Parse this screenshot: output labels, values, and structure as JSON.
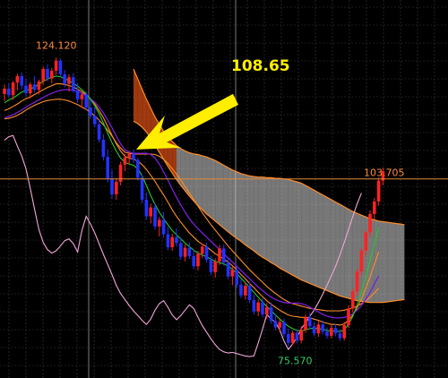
{
  "colors": {
    "background": "#000000",
    "grid": "#3a3a3a",
    "grid_major": "#8a8a8a",
    "bull": "#ff2222",
    "bear": "#2233ff",
    "tenkan": "#22cc22",
    "kijun": "#7a1fd9",
    "chikou": "#f2a6d6",
    "span_a": "#ff8c28",
    "span_b": "#ff8c28",
    "cloud_bull": "#d8d8d8",
    "cloud_bear": "#d24b14",
    "hline": "#e08a3c",
    "label_high": "#ff8a3a",
    "label_low": "#33cc66",
    "callout": "#ffee00",
    "callout_text": "#ffee00"
  },
  "labels": {
    "high": "124.120",
    "low": "75.570",
    "last": "103.705",
    "callout": "108.65"
  },
  "chart_data": {
    "type": "candlestick",
    "title": "",
    "xlabel": "",
    "ylabel": "",
    "ylim": [
      72,
      132
    ],
    "grid": true,
    "horizontal_line": 103.705,
    "annotations": [
      {
        "text": "124.120",
        "value": 124.12,
        "kind": "high"
      },
      {
        "text": "75.570",
        "value": 75.57,
        "kind": "low"
      },
      {
        "text": "103.705",
        "value": 103.705,
        "kind": "last"
      },
      {
        "text": "108.65",
        "value": 108.65,
        "kind": "callout-arrow"
      }
    ],
    "candles": [
      [
        118.0,
        119.6,
        116.8,
        118.9
      ],
      [
        118.9,
        119.8,
        117.4,
        117.8
      ],
      [
        117.8,
        120.2,
        117.0,
        119.9
      ],
      [
        119.9,
        121.4,
        118.6,
        121.0
      ],
      [
        121.0,
        121.6,
        118.8,
        119.4
      ],
      [
        119.4,
        120.6,
        117.6,
        118.1
      ],
      [
        118.1,
        120.0,
        117.2,
        119.6
      ],
      [
        119.6,
        121.0,
        118.2,
        118.7
      ],
      [
        118.7,
        120.4,
        117.9,
        120.1
      ],
      [
        120.1,
        122.6,
        119.5,
        122.2
      ],
      [
        122.2,
        123.0,
        120.1,
        120.6
      ],
      [
        120.6,
        122.4,
        119.8,
        121.9
      ],
      [
        121.9,
        124.1,
        121.2,
        123.6
      ],
      [
        123.6,
        123.9,
        120.9,
        121.3
      ],
      [
        121.3,
        122.0,
        119.1,
        119.7
      ],
      [
        119.7,
        121.3,
        118.4,
        120.8
      ],
      [
        120.8,
        121.5,
        118.2,
        118.6
      ],
      [
        118.6,
        119.8,
        116.5,
        117.1
      ],
      [
        117.1,
        118.5,
        115.6,
        117.9
      ],
      [
        117.9,
        118.4,
        115.2,
        115.7
      ],
      [
        115.7,
        116.9,
        113.8,
        114.3
      ],
      [
        114.3,
        115.8,
        112.4,
        112.9
      ],
      [
        112.9,
        113.6,
        109.8,
        110.3
      ],
      [
        110.3,
        111.2,
        106.8,
        107.4
      ],
      [
        107.4,
        108.6,
        103.1,
        103.8
      ],
      [
        103.8,
        105.2,
        100.4,
        101.1
      ],
      [
        101.1,
        103.8,
        100.2,
        103.2
      ],
      [
        103.2,
        106.6,
        102.6,
        106.1
      ],
      [
        106.1,
        107.9,
        105.0,
        107.3
      ],
      [
        107.3,
        108.3,
        106.2,
        107.9
      ],
      [
        107.9,
        108.65,
        106.4,
        106.9
      ],
      [
        106.9,
        107.2,
        103.4,
        103.9
      ],
      [
        103.9,
        104.5,
        99.6,
        100.2
      ],
      [
        100.2,
        101.4,
        96.8,
        97.4
      ],
      [
        97.4,
        99.5,
        96.2,
        98.9
      ],
      [
        98.9,
        99.6,
        95.1,
        95.7
      ],
      [
        95.7,
        97.3,
        94.0,
        96.8
      ],
      [
        96.8,
        98.1,
        93.8,
        94.4
      ],
      [
        94.4,
        95.6,
        91.7,
        92.2
      ],
      [
        92.2,
        94.5,
        91.6,
        93.9
      ],
      [
        93.9,
        95.4,
        92.3,
        92.9
      ],
      [
        92.9,
        93.8,
        90.1,
        90.6
      ],
      [
        90.6,
        92.7,
        89.8,
        92.1
      ],
      [
        92.1,
        93.0,
        90.2,
        90.7
      ],
      [
        90.7,
        91.8,
        88.5,
        89.0
      ],
      [
        89.0,
        91.6,
        88.3,
        91.1
      ],
      [
        91.1,
        92.8,
        90.4,
        92.3
      ],
      [
        92.3,
        93.0,
        89.6,
        90.1
      ],
      [
        90.1,
        90.8,
        87.5,
        88.0
      ],
      [
        88.0,
        90.3,
        87.1,
        89.8
      ],
      [
        89.8,
        92.6,
        89.2,
        92.0
      ],
      [
        92.0,
        92.7,
        89.1,
        89.6
      ],
      [
        89.6,
        90.4,
        86.8,
        87.3
      ],
      [
        87.3,
        89.0,
        85.8,
        88.4
      ],
      [
        88.4,
        89.1,
        85.4,
        85.9
      ],
      [
        85.9,
        86.8,
        83.6,
        84.1
      ],
      [
        84.1,
        86.3,
        83.4,
        85.7
      ],
      [
        85.7,
        86.4,
        82.8,
        83.3
      ],
      [
        83.3,
        84.2,
        80.9,
        81.4
      ],
      [
        81.4,
        83.5,
        80.6,
        82.9
      ],
      [
        82.9,
        83.6,
        80.4,
        80.9
      ],
      [
        80.9,
        82.8,
        80.1,
        82.1
      ],
      [
        82.1,
        82.9,
        79.3,
        79.8
      ],
      [
        79.8,
        81.0,
        78.2,
        78.7
      ],
      [
        78.7,
        80.3,
        77.9,
        79.6
      ],
      [
        79.6,
        80.2,
        77.1,
        77.6
      ],
      [
        77.6,
        78.5,
        75.57,
        76.1
      ],
      [
        76.1,
        78.2,
        75.7,
        77.8
      ],
      [
        77.8,
        78.4,
        76.0,
        76.5
      ],
      [
        76.5,
        78.9,
        76.0,
        78.3
      ],
      [
        78.3,
        80.9,
        77.8,
        80.4
      ],
      [
        80.4,
        81.1,
        78.4,
        78.9
      ],
      [
        78.9,
        79.6,
        77.2,
        77.7
      ],
      [
        77.7,
        79.8,
        77.1,
        79.2
      ],
      [
        79.2,
        79.9,
        77.5,
        78.0
      ],
      [
        78.0,
        78.7,
        76.8,
        77.3
      ],
      [
        77.3,
        79.1,
        76.9,
        78.6
      ],
      [
        78.6,
        79.3,
        77.2,
        77.7
      ],
      [
        77.7,
        78.4,
        76.4,
        76.9
      ],
      [
        76.9,
        79.6,
        76.5,
        79.1
      ],
      [
        79.1,
        82.4,
        78.6,
        81.9
      ],
      [
        81.9,
        85.3,
        81.2,
        84.8
      ],
      [
        84.8,
        88.6,
        84.0,
        88.1
      ],
      [
        88.1,
        92.1,
        87.4,
        91.6
      ],
      [
        91.6,
        95.2,
        90.8,
        94.7
      ],
      [
        94.7,
        98.4,
        93.9,
        97.8
      ],
      [
        97.8,
        100.5,
        96.9,
        99.9
      ],
      [
        99.9,
        103.9,
        99.2,
        103.4
      ],
      [
        103.4,
        105.6,
        102.6,
        105.0
      ]
    ],
    "series": [
      {
        "name": "",
        "kind": "tenkan",
        "start": 0,
        "values": [
          116.5,
          117.0,
          117.3,
          117.8,
          118.3,
          118.6,
          118.8,
          119.2,
          119.6,
          120.1,
          120.5,
          120.8,
          121.0,
          120.9,
          120.6,
          120.2,
          119.8,
          119.3,
          118.7,
          118.0,
          117.1,
          116.0,
          114.7,
          113.1,
          111.4,
          109.8,
          108.4,
          107.2,
          106.5,
          106.2,
          106.0,
          105.4,
          104.2,
          102.6,
          100.9,
          99.4,
          98.1,
          97.0,
          96.0,
          95.0,
          94.3,
          93.6,
          92.9,
          92.3,
          91.7,
          91.2,
          90.9,
          90.6,
          90.2,
          89.8,
          89.6,
          89.4,
          89.0,
          88.5,
          87.8,
          87.0,
          86.2,
          85.4,
          84.6,
          83.8,
          83.0,
          82.2,
          81.5,
          80.8,
          80.1,
          79.5,
          78.9,
          78.5,
          78.2,
          78.1,
          78.3,
          78.5,
          78.6,
          78.5,
          78.4,
          78.2,
          78.1,
          78.1,
          78.0,
          78.3,
          79.2,
          80.6,
          82.5,
          84.7,
          87.2,
          89.9,
          92.7,
          95.5
        ]
      },
      {
        "name": "",
        "kind": "kijun",
        "start": 0,
        "values": [
          114.0,
          114.2,
          114.5,
          114.9,
          115.3,
          115.8,
          116.2,
          116.6,
          117.0,
          117.4,
          117.8,
          118.1,
          118.4,
          118.6,
          118.7,
          118.7,
          118.6,
          118.4,
          118.1,
          117.7,
          117.2,
          116.6,
          115.8,
          114.8,
          113.6,
          112.3,
          110.9,
          109.6,
          108.6,
          108.2,
          108.0,
          108.0,
          108.0,
          108.0,
          107.8,
          107.2,
          106.2,
          104.9,
          103.5,
          102.0,
          100.6,
          99.3,
          98.1,
          97.0,
          96.1,
          95.3,
          94.6,
          93.9,
          93.2,
          92.5,
          91.8,
          91.1,
          90.4,
          89.7,
          89.0,
          88.3,
          87.6,
          86.9,
          86.2,
          85.5,
          84.9,
          84.3,
          83.8,
          83.4,
          83.1,
          82.9,
          82.8,
          82.8,
          82.8,
          82.7,
          82.5,
          82.1,
          81.7,
          81.3,
          80.9,
          80.6,
          80.4,
          80.3,
          80.3,
          80.4,
          80.6,
          81.0,
          81.6,
          82.4,
          83.4,
          84.6,
          86.0,
          87.4
        ]
      },
      {
        "name": "",
        "kind": "chikou",
        "start": 0,
        "values": [
          110.2,
          110.8,
          111.0,
          109.2,
          107.6,
          105.4,
          102.1,
          98.6,
          95.2,
          93.0,
          91.8,
          91.2,
          91.6,
          92.4,
          93.3,
          93.6,
          92.8,
          91.4,
          95.0,
          97.4,
          96.1,
          94.6,
          92.8,
          91.0,
          89.3,
          87.6,
          85.8,
          84.4,
          83.4,
          82.4,
          81.5,
          80.7,
          79.9,
          79.2,
          80.1,
          81.6,
          82.7,
          83.2,
          82.1,
          80.8,
          80.0,
          80.7,
          81.6,
          82.5,
          81.9,
          80.4,
          79.0,
          77.9,
          76.8,
          75.8,
          75.0,
          74.6,
          74.4,
          74.5,
          74.3,
          74.1,
          73.9,
          73.8,
          73.9,
          76.1,
          78.4,
          80.9,
          80.1,
          79.6,
          78.3,
          76.4,
          75.0,
          75.9,
          77.0,
          78.5,
          79.4,
          80.6,
          81.6,
          82.9,
          84.3,
          85.8,
          87.4,
          89.0,
          90.9,
          93.0,
          95.2,
          97.4,
          99.5,
          101.3
        ]
      },
      {
        "name": "",
        "kind": "span_a",
        "start": 0,
        "values": [
          115.2,
          115.5,
          115.9,
          116.3,
          116.8,
          117.2,
          117.5,
          117.9,
          118.3,
          118.7,
          119.1,
          119.4,
          119.7,
          119.7,
          119.6,
          119.4,
          119.2,
          118.8,
          118.4,
          117.8,
          117.1,
          116.3,
          115.2,
          114.0,
          112.5,
          111.0,
          109.6,
          108.4,
          107.5,
          107.2,
          107.0,
          106.7,
          106.1,
          105.3,
          104.3,
          103.3,
          102.1,
          101.0,
          99.8,
          98.5,
          97.4,
          96.4,
          95.5,
          94.6,
          93.9,
          93.2,
          92.7,
          92.3,
          91.7,
          91.1,
          90.7,
          90.2,
          89.7,
          89.1,
          88.4,
          87.6,
          86.9,
          86.1,
          85.4,
          84.6,
          83.9,
          83.2,
          82.6,
          82.1,
          81.6,
          81.2,
          80.8,
          80.6,
          80.5,
          80.4,
          80.4,
          80.3,
          80.1,
          79.9,
          79.6,
          79.4,
          79.2,
          79.2,
          79.1,
          79.3,
          79.9,
          80.8,
          82.0,
          83.5,
          85.3,
          87.2,
          89.3,
          91.4
        ]
      },
      {
        "name": "",
        "kind": "span_b",
        "start": 0,
        "values": [
          113.8,
          113.9,
          114.1,
          114.4,
          114.8,
          115.3,
          115.7,
          116.1,
          116.4,
          116.7,
          116.9,
          117.0,
          117.1,
          117.1,
          117.0,
          116.8,
          116.5,
          116.2,
          115.8,
          115.4,
          114.9,
          114.3,
          113.6,
          112.8,
          111.9,
          110.9,
          109.8,
          108.9,
          108.2,
          108.0,
          107.9,
          107.9,
          107.9,
          107.9,
          107.9,
          107.8,
          107.5,
          107.0,
          106.3,
          105.4,
          104.5,
          103.5,
          102.4,
          101.3,
          100.2,
          99.1,
          98.0,
          97.0,
          96.0,
          95.1,
          94.2,
          93.3,
          92.4,
          91.6,
          90.8,
          90.0,
          89.2,
          88.4,
          87.7,
          87.0,
          86.3,
          85.6,
          85.0,
          84.4,
          83.9,
          83.4,
          83.0,
          82.7,
          82.5,
          82.3,
          82.1,
          81.9,
          81.8,
          81.7,
          81.6,
          81.5,
          81.5,
          81.5,
          81.5,
          81.6,
          81.8,
          82.0,
          82.3,
          82.7,
          83.2,
          83.8,
          84.5,
          85.3
        ]
      },
      {
        "name": "",
        "kind": "cloud_upper",
        "start": 30,
        "values": [
          122.2,
          120.5,
          118.8,
          117.1,
          115.6,
          114.1,
          112.9,
          111.7,
          110.8,
          110.0,
          109.3,
          108.8,
          108.4,
          108.1,
          107.9,
          107.8,
          107.6,
          107.4,
          107.1,
          106.8,
          106.4,
          106.0,
          105.6,
          105.2,
          104.9,
          104.6,
          104.4,
          104.2,
          104.1,
          104.0,
          104.0,
          103.9,
          103.9,
          103.8,
          103.8,
          103.7,
          103.6,
          103.4,
          103.2,
          103.0,
          102.6,
          102.2,
          101.8,
          101.4,
          101.0,
          100.6,
          100.2,
          99.8,
          99.4,
          99.0,
          98.6,
          98.2,
          97.9,
          97.6,
          97.3,
          97.0,
          96.8,
          96.6,
          96.5,
          96.4,
          96.3,
          96.2,
          96.1,
          96.0
        ]
      },
      {
        "name": "",
        "kind": "cloud_lower",
        "start": 30,
        "values": [
          113.4,
          113.0,
          112.4,
          111.6,
          110.6,
          109.4,
          108.2,
          107.0,
          105.8,
          104.7,
          103.6,
          102.6,
          101.7,
          100.8,
          100.0,
          99.2,
          98.5,
          97.8,
          97.2,
          96.6,
          96.0,
          95.4,
          94.8,
          94.2,
          93.7,
          93.2,
          92.6,
          92.1,
          91.6,
          91.0,
          90.5,
          90.1,
          89.6,
          89.2,
          88.7,
          88.3,
          87.9,
          87.5,
          87.1,
          86.7,
          86.4,
          86.1,
          85.8,
          85.5,
          85.2,
          84.9,
          84.6,
          84.3,
          84.0,
          83.8,
          83.6,
          83.4,
          83.2,
          83.1,
          83.0,
          82.9,
          82.9,
          82.9,
          82.9,
          83.0,
          83.1,
          83.2,
          83.3,
          83.4
        ]
      }
    ]
  }
}
